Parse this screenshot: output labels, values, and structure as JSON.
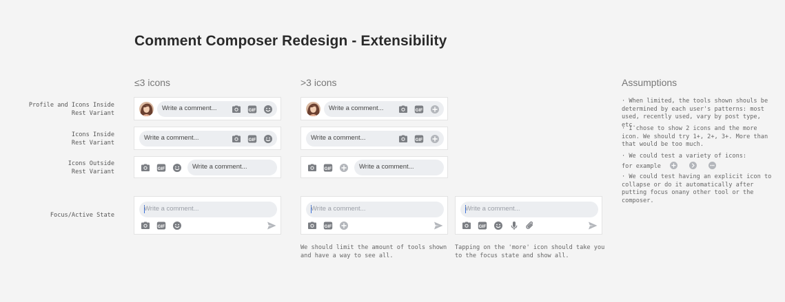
{
  "title": "Comment Composer Redesign - Extensibility",
  "columns": {
    "le3": "≤3 icons",
    "gt3": ">3 icons",
    "assumptions": "Assumptions"
  },
  "row_labels": {
    "profile": [
      "Profile and Icons Inside",
      "Rest Variant"
    ],
    "inside": [
      "Icons Inside",
      "Rest Variant"
    ],
    "outside": [
      "Icons Outside",
      "Rest Variant"
    ],
    "focus": "Focus/Active State"
  },
  "composer": {
    "placeholder": "Write a comment..."
  },
  "notes": {
    "gt3_focus": "We should limit the amount of tools shown\nand have a way to see all.",
    "more_focus": "Tapping on the 'more' icon should take you\nto the focus state and show all."
  },
  "assumptions": [
    "· When limited, the tools shown shouls be determined by each user's patterns: most used, recently used, vary by post type, etc.",
    "· I chose to show 2 icons and the more icon. We should try 1+, 2+, 3+. More than that would be too much.",
    "· We could test a variety of icons:",
    "for example",
    "· We could test having an explicit icon to collapse or do it automatically after putting focus onany other tool or the composer."
  ],
  "icons": [
    "avatar",
    "camera-icon",
    "gif-icon",
    "emoji-icon",
    "plus-icon",
    "send-icon",
    "mic-icon",
    "attach-icon",
    "chevron-right-icon",
    "more-icon"
  ],
  "colors": {
    "icon": "#7b7e83",
    "icon_light": "#b3b6bb",
    "pill": "#eceef1",
    "caret": "#3a6fd8"
  }
}
